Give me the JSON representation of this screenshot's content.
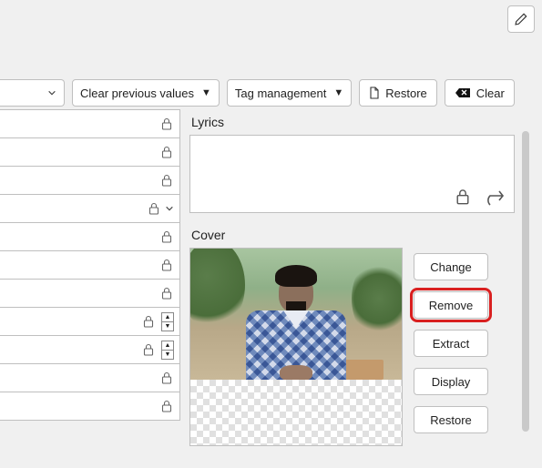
{
  "toolbar": {
    "clear_prev": "Clear previous values",
    "tag_mgmt": "Tag management",
    "restore": "Restore",
    "clear": "Clear"
  },
  "sections": {
    "lyrics": "Lyrics",
    "cover": "Cover"
  },
  "cover_buttons": {
    "change": "Change",
    "remove": "Remove",
    "extract": "Extract",
    "display": "Display",
    "restore": "Restore"
  }
}
